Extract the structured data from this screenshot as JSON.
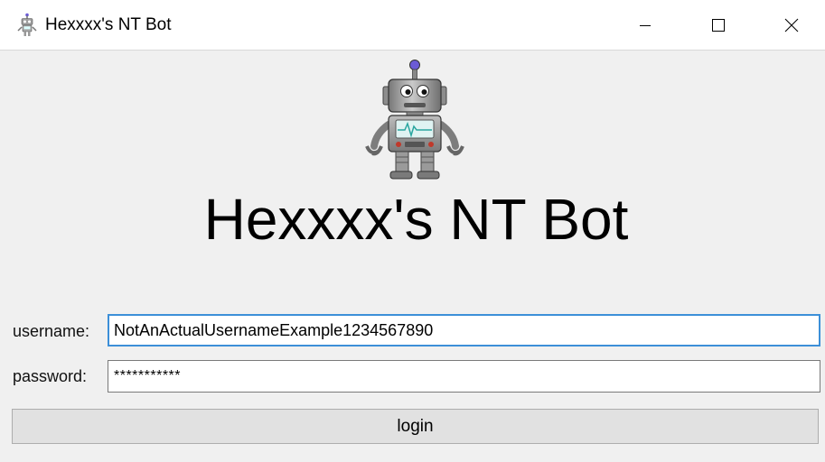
{
  "window": {
    "title": "Hexxxx's NT Bot"
  },
  "icons": {
    "app": "robot-icon",
    "minimize": "minimize-icon",
    "maximize": "maximize-icon",
    "close": "close-icon"
  },
  "main": {
    "heading": "Hexxxx's NT Bot"
  },
  "form": {
    "username_label": "username:",
    "username_value": "NotAnActualUsernameExample1234567890",
    "password_label": "password:",
    "password_value": "***********",
    "login_label": "login"
  },
  "colors": {
    "focus_border": "#3c8fd8",
    "robot_body": "#9e9e9e",
    "robot_antenna": "#6b5bd6"
  }
}
